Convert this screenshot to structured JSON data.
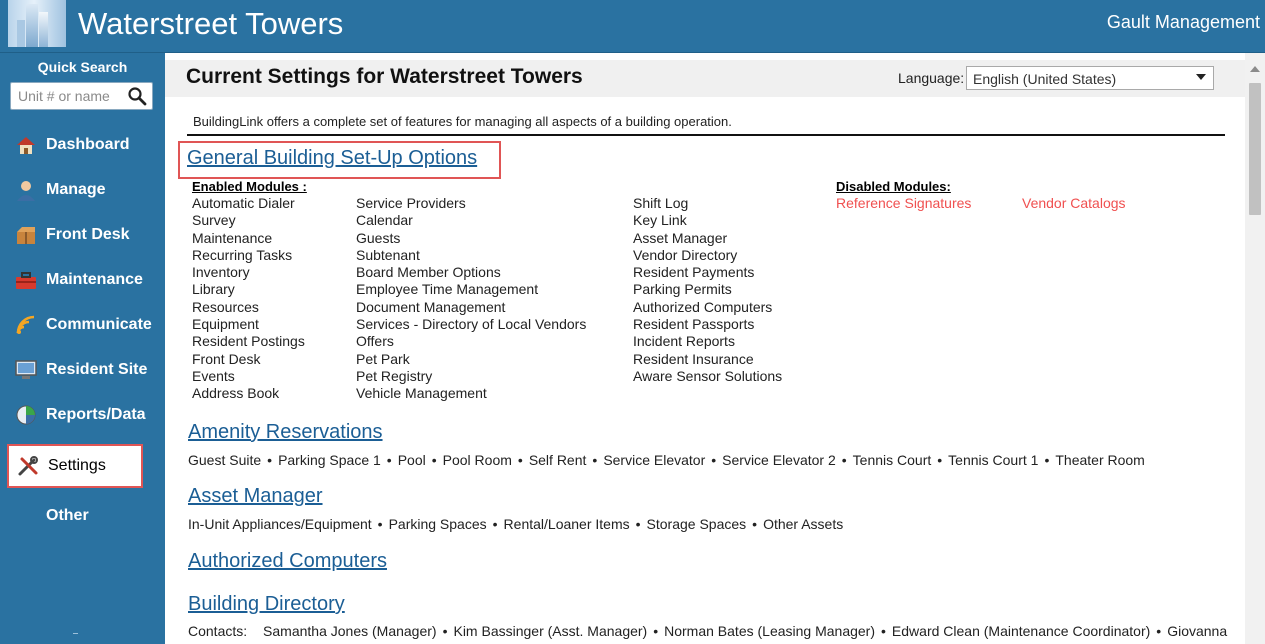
{
  "header": {
    "site_title": "Waterstreet Towers",
    "company": "Gault Management"
  },
  "sidebar": {
    "quick_search_label": "Quick Search",
    "search_placeholder": "Unit # or name",
    "items": [
      {
        "label": "Dashboard",
        "icon": "house-icon"
      },
      {
        "label": "Manage",
        "icon": "person-icon"
      },
      {
        "label": "Front Desk",
        "icon": "package-icon"
      },
      {
        "label": "Maintenance",
        "icon": "toolbox-icon"
      },
      {
        "label": "Communicate",
        "icon": "wifi-icon"
      },
      {
        "label": "Resident Site",
        "icon": "monitor-icon"
      },
      {
        "label": "Reports/Data",
        "icon": "pie-chart-icon"
      },
      {
        "label": "Settings",
        "icon": "tools-icon",
        "selected": true
      },
      {
        "label": "Other",
        "icon": ""
      }
    ]
  },
  "main": {
    "page_title": "Current Settings for Waterstreet Towers",
    "language_label": "Language:",
    "language_value": "English (United States)",
    "intro": "BuildingLink offers a complete set of features for managing all aspects of a building operation.",
    "general": {
      "title": "General Building Set-Up Options",
      "enabled_label": "Enabled Modules :",
      "disabled_label": "Disabled Modules:",
      "enabled_columns": [
        [
          "Automatic Dialer",
          "Survey",
          "Maintenance",
          "Recurring Tasks",
          "Inventory",
          "Library",
          "Resources",
          "Equipment",
          "Resident Postings",
          "Front Desk",
          "Events",
          "Address Book"
        ],
        [
          "Service Providers",
          "Calendar",
          "Guests",
          "Subtenant",
          "Board Member Options",
          "Employee Time Management",
          "Document Management",
          "Services - Directory of Local Vendors",
          "Offers",
          "Pet Park",
          "Pet Registry",
          "Vehicle Management"
        ],
        [
          "Shift Log",
          "Key Link",
          "Asset Manager",
          "Vendor Directory",
          "Resident Payments",
          "Parking Permits",
          "Authorized Computers",
          "Resident Passports",
          "Incident Reports",
          "Resident Insurance",
          "Aware Sensor Solutions"
        ]
      ],
      "disabled": [
        "Reference Signatures",
        "Vendor Catalogs"
      ]
    },
    "amenity": {
      "title": "Amenity Reservations",
      "items": [
        "Guest Suite",
        "Parking Space 1",
        "Pool",
        "Pool Room",
        "Self Rent",
        "Service Elevator",
        "Service Elevator 2",
        "Tennis Court",
        "Tennis Court 1",
        "Theater Room"
      ]
    },
    "asset": {
      "title": "Asset Manager",
      "items": [
        "In-Unit Appliances/Equipment",
        "Parking Spaces",
        "Rental/Loaner Items",
        "Storage Spaces",
        "Other Assets"
      ]
    },
    "authorized": {
      "title": "Authorized Computers"
    },
    "directory": {
      "title": "Building Directory",
      "contacts_label": "Contacts:",
      "contacts": [
        "Samantha Jones (Manager)",
        "Kim Bassinger (Asst. Manager)",
        "Norman Bates (Leasing Manager)",
        "Edward Clean (Maintenance Coordinator)",
        "Giovanna"
      ]
    }
  },
  "colors": {
    "brand_blue": "#2a72a1",
    "link_blue": "#1b5e95",
    "disabled_red": "#f05050",
    "highlight_red": "#e05555"
  }
}
